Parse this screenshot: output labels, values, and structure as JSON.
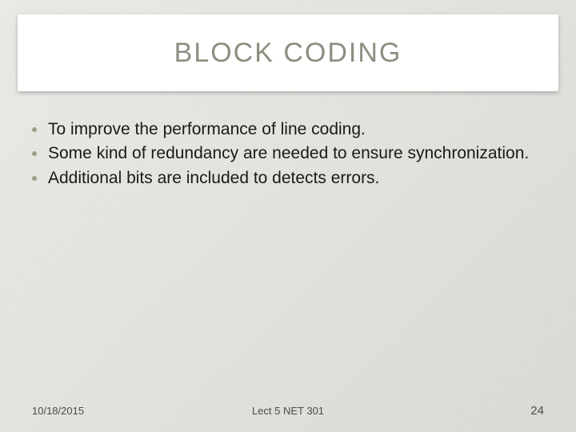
{
  "slide": {
    "title": "BLOCK CODING",
    "bullets": [
      "To improve the performance of line coding.",
      "Some kind of redundancy are needed to ensure synchronization.",
      "Additional bits are included to detects errors."
    ],
    "footer": {
      "date": "10/18/2015",
      "center": "Lect 5    NET 301",
      "page": "24"
    }
  }
}
